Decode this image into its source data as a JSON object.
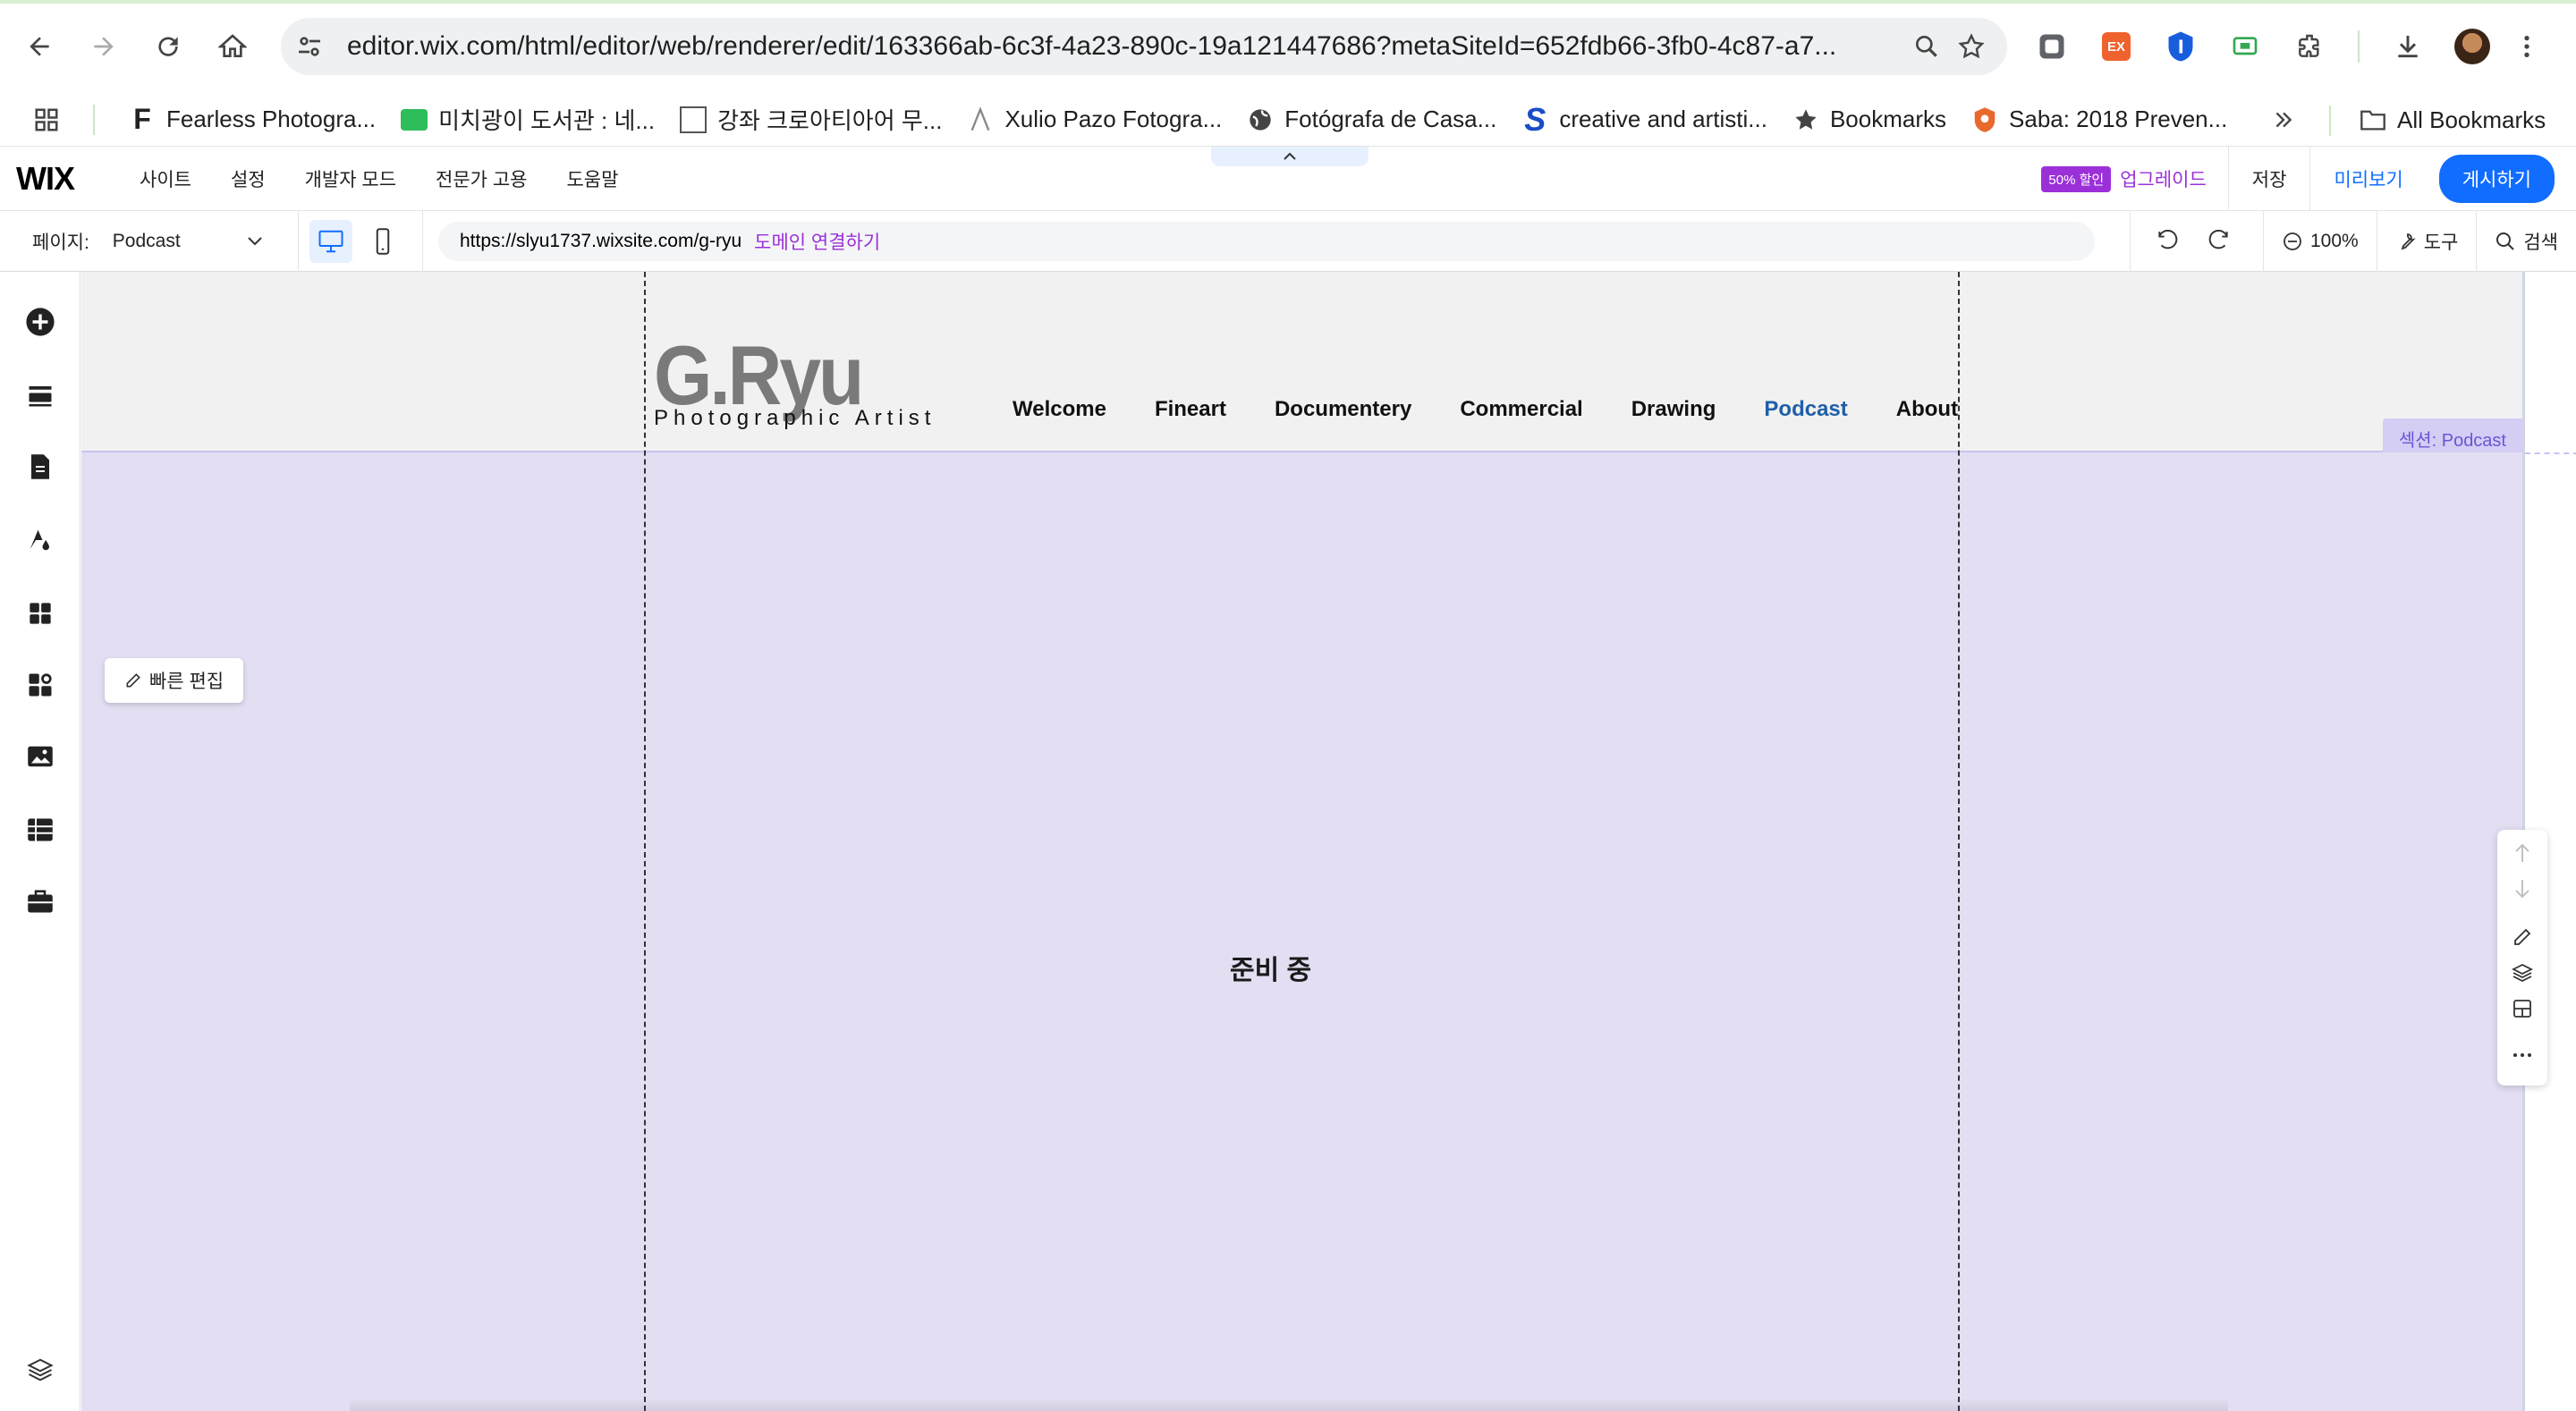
{
  "browser": {
    "url": "editor.wix.com/html/editor/web/renderer/edit/163366ab-6c3f-4a23-890c-19a121447686?metaSiteId=652fdb66-3fb0-4c87-a7...",
    "bookmarks": [
      {
        "label": "Fearless Photogra...",
        "icon": "f-letter-icon"
      },
      {
        "label": "미치광이 도서관 : 네...",
        "icon": "blog-icon"
      },
      {
        "label": "강좌 크로아티아어 무...",
        "icon": "korean-char-icon"
      },
      {
        "label": "Xulio Pazo Fotogra...",
        "icon": "lambda-icon"
      },
      {
        "label": "Fotógrafa de Casa...",
        "icon": "globe-icon"
      },
      {
        "label": "creative and artisti...",
        "icon": "s-letter-icon"
      },
      {
        "label": "Bookmarks",
        "icon": "star-icon"
      },
      {
        "label": "Saba: 2018 Preven...",
        "icon": "shield-icon"
      }
    ],
    "all_bookmarks": "All Bookmarks",
    "ext_ex_label": "EX"
  },
  "wix": {
    "logo": "WIX",
    "menu": [
      "사이트",
      "설정",
      "개발자 모드",
      "전문가 고용",
      "도움말"
    ],
    "badge": "50% 할인",
    "upgrade": "업그레이드",
    "save": "저장",
    "preview": "미리보기",
    "publish": "게시하기",
    "page_label": "페이지:",
    "page_value": "Podcast",
    "site_url": "https://slyu1737.wixsite.com/g-ryu",
    "connect_domain": "도메인 연결하기",
    "zoom": "100%",
    "tools": "도구",
    "search": "검색"
  },
  "site": {
    "logo": "G.Ryu",
    "tagline": "Photographic Artist",
    "nav": [
      "Welcome",
      "Fineart",
      "Documentery",
      "Commercial",
      "Drawing",
      "Podcast",
      "About"
    ],
    "active_nav": "Podcast",
    "section_label": "섹션: Podcast",
    "quick_edit": "빠른 편집",
    "center_text": "준비 중"
  },
  "colors": {
    "accent": "#116dff",
    "upgrade_purple": "#9b30d9",
    "section_bg": "#e3def2",
    "active_nav": "#1f5fa8"
  }
}
